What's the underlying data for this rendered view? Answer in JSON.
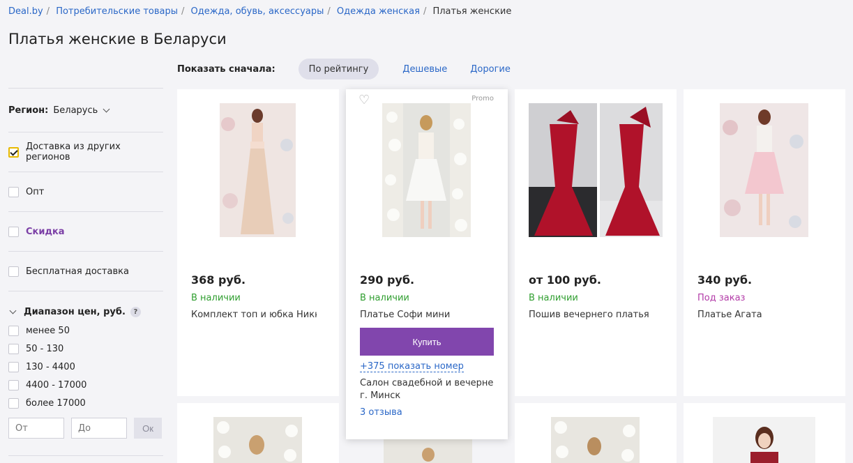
{
  "breadcrumb": [
    "Deal.by",
    "Потребительские товары",
    "Одежда, обувь, аксессуары",
    "Одежда женская",
    "Платья женские"
  ],
  "page_title": "Платья женские в Беларуси",
  "sort": {
    "label": "Показать сначала:",
    "active": "По рейтингу",
    "options": [
      "Дешевые",
      "Дорогие"
    ]
  },
  "sidebar": {
    "region_label": "Регион:",
    "region_value": "Беларусь",
    "filters": [
      {
        "label": "Доставка из других регионов",
        "checked": true
      },
      {
        "label": "Опт",
        "checked": false
      },
      {
        "label": "Скидка",
        "checked": false
      },
      {
        "label": "Бесплатная доставка",
        "checked": false
      }
    ],
    "price_range": {
      "title": "Диапазон цен, руб.",
      "help": "?",
      "ranges": [
        "менее 50",
        "50 - 130",
        "130 - 4400",
        "4400 - 17000",
        "более 17000"
      ],
      "from_placeholder": "От",
      "to_placeholder": "До",
      "ok_label": "Ок"
    }
  },
  "products": [
    {
      "price": "368 руб.",
      "availability": "В наличии",
      "name": "Комплект топ и юбка Никки",
      "image_colors": [
        "#efe5e2",
        "#e8cdb8"
      ]
    },
    {
      "price": "290 руб.",
      "availability": "В наличии",
      "name": "Платье Софи мини",
      "promo": "Promo",
      "buy": "Купить",
      "phone": "+375 показать номер",
      "seller": "Салон свадебной и вечерней",
      "city": "г. Минск",
      "reviews": "3 отзыва",
      "image_colors": [
        "#e4e4e0",
        "#f8f8f6"
      ]
    },
    {
      "price": "от 100 руб.",
      "availability": "В наличии",
      "name": "Пошив вечернего платья",
      "image_colors": [
        "#cfcfd2",
        "#b0122a"
      ]
    },
    {
      "price": "340 руб.",
      "availability": "Под заказ",
      "name": "Платье Агата",
      "image_colors": [
        "#efe6e6",
        "#f3c7cf"
      ]
    }
  ]
}
